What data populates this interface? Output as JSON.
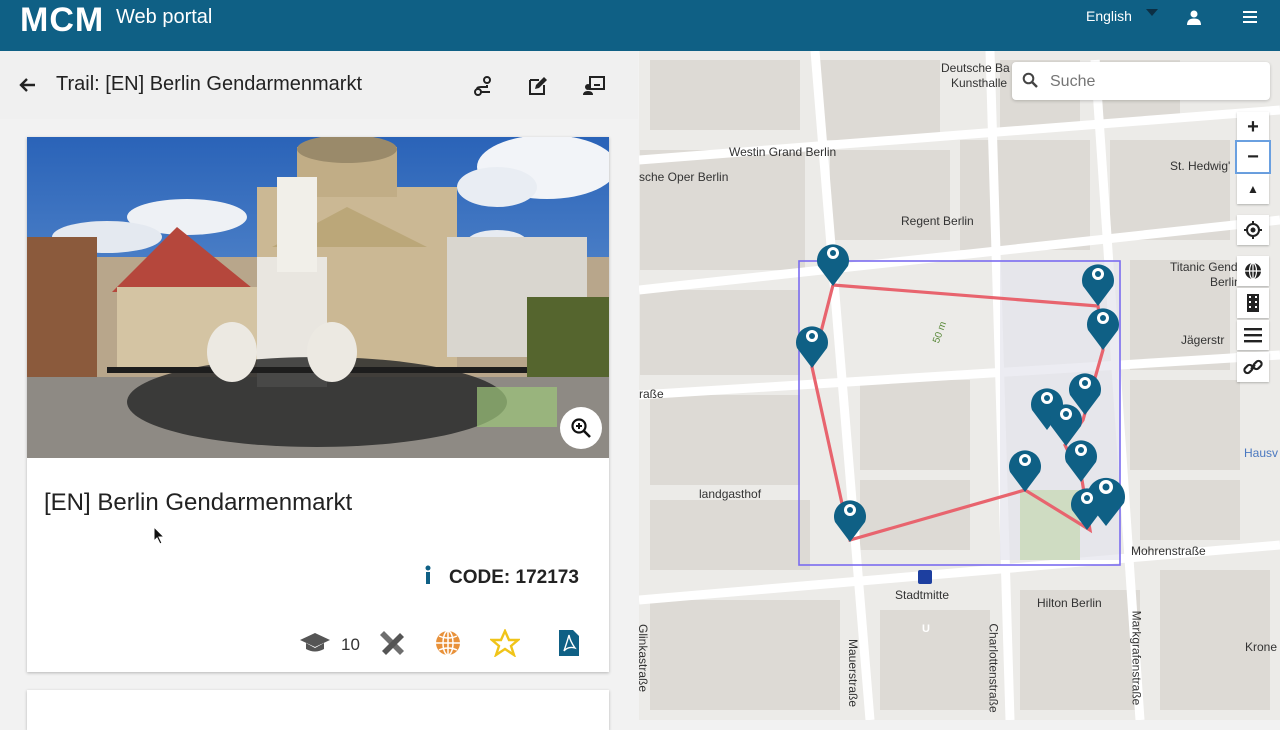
{
  "app": {
    "logo": "MCM",
    "title": "Web portal"
  },
  "topbar": {
    "language": "English",
    "user_icon": "user-icon",
    "menu_icon": "hamburger-menu-icon"
  },
  "trail_header": {
    "back_icon": "arrow-left-icon",
    "title": "Trail: [EN] Berlin Gendarmenmarkt",
    "actions": [
      "route-icon",
      "edit-icon",
      "assign-icon"
    ]
  },
  "card": {
    "title": "[EN] Berlin Gendarmenmarkt",
    "code_label": "CODE: 172173",
    "grade_count": "10",
    "zoom_icon": "zoom-in-icon",
    "icons": [
      "graduation-cap-icon",
      "tools-icon",
      "globe-icon",
      "star-icon",
      "pdf-icon",
      "info-icon"
    ]
  },
  "map": {
    "search_placeholder": "Suche",
    "controls": [
      "+",
      "−",
      "▲",
      "⊙",
      "globe",
      "building",
      "layers",
      "link"
    ],
    "labels": {
      "deutsche": "Deutsche Ba",
      "kunsthalle": "Kunsthalle",
      "westin": "Westin Grand Berlin",
      "oper": "sche Oper Berlin",
      "regent": "Regent Berlin",
      "titanic": "Titanic Gendarme",
      "titanic2": "Berlin",
      "jager": "Jägerstr",
      "hedwig": "St. Hedwig'",
      "strasse": "raße",
      "landgasthof": "landgasthof",
      "mohren": "Mohrenstraße",
      "stadtmitte": "Stadtmitte",
      "hilton": "Hilton Berlin",
      "haus": "Hausv",
      "krone": "Krone",
      "glinka": "Glinkastraße",
      "mauer": "Mauerstraße",
      "charlotten": "Charlottenstraße",
      "markgrafen": "Markgrafenstraße",
      "scale": "50 m",
      "ubahn": "U"
    },
    "colors": {
      "route": "#e8646e",
      "marker": "#0f6085",
      "bbox": "#7b6cf0"
    }
  }
}
